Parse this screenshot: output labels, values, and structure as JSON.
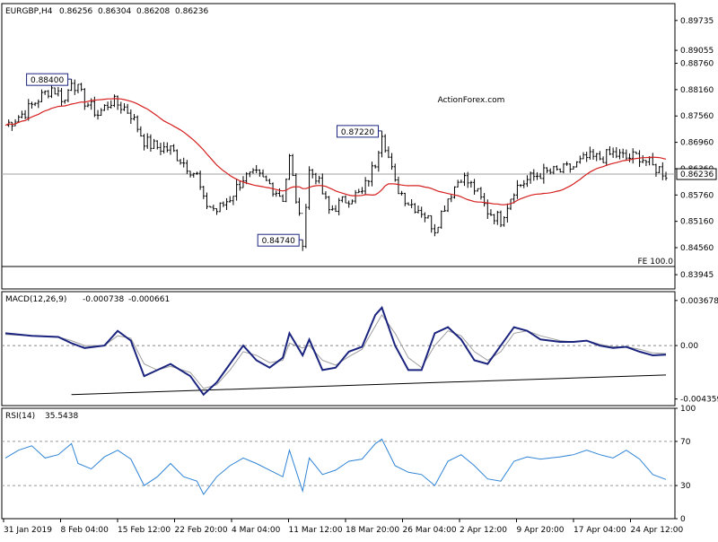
{
  "watermark": "ActionForex.com",
  "colors": {
    "background": "#ffffff",
    "frame": "#000000",
    "candle": "#000000",
    "ma": "#d62020",
    "macd": "#1a237e",
    "signal": "#9e9e9e",
    "rsi": "#2f84d6",
    "trendline": "#000000",
    "price_line": "#a0a0a0",
    "label_border": "#1a237e"
  },
  "chart_data": [
    {
      "type": "candlestick",
      "title": "EURGBP,H4",
      "ohlc_readout": [
        "0.86256",
        "0.86304",
        "0.86208",
        "0.86236"
      ],
      "ylim": [
        0.8362,
        0.9012
      ],
      "y_ticks": [
        "0.89735",
        "0.89055",
        "0.88760",
        "0.88160",
        "0.87560",
        "0.86960",
        "0.86360",
        "0.85760",
        "0.85160",
        "0.84560",
        "0.83945"
      ],
      "y_tick_values": [
        0.89735,
        0.89055,
        0.8876,
        0.8816,
        0.8756,
        0.8696,
        0.8636,
        0.8576,
        0.8516,
        0.8456,
        0.83945
      ],
      "current_price_label": "0.86236",
      "current_price": 0.86236,
      "fe_line_label": "FE 100.0",
      "fe_line_value": 0.8413,
      "ma_overlay": true,
      "x_ticks": [
        "31 Jan 2019",
        "8 Feb 04:00",
        "15 Feb 12:00",
        "22 Feb 20:00",
        "4 Mar 04:00",
        "11 Mar 12:00",
        "18 Mar 20:00",
        "26 Mar 04:00",
        "2 Apr 12:00",
        "9 Apr 20:00",
        "17 Apr 04:00",
        "24 Apr 12:00"
      ],
      "annotations": [
        {
          "label": "0.88400",
          "value": 0.884,
          "x_index": 10
        },
        {
          "label": "0.87220",
          "value": 0.8722,
          "x_index": 57
        },
        {
          "label": "0.84740",
          "value": 0.8474,
          "x_index": 45
        }
      ],
      "anchors": [
        [
          0,
          0.8735
        ],
        [
          3,
          0.8765
        ],
        [
          5,
          0.8795
        ],
        [
          7,
          0.882
        ],
        [
          8,
          0.8808
        ],
        [
          9,
          0.879
        ],
        [
          10,
          0.884
        ],
        [
          12,
          0.879
        ],
        [
          14,
          0.876
        ],
        [
          16,
          0.879
        ],
        [
          18,
          0.8775
        ],
        [
          19,
          0.876
        ],
        [
          21,
          0.87
        ],
        [
          22,
          0.869
        ],
        [
          23,
          0.8685
        ],
        [
          25,
          0.868
        ],
        [
          27,
          0.865
        ],
        [
          29,
          0.862
        ],
        [
          30,
          0.856
        ],
        [
          32,
          0.854
        ],
        [
          34,
          0.857
        ],
        [
          36,
          0.8615
        ],
        [
          38,
          0.862
        ],
        [
          40,
          0.86
        ],
        [
          42,
          0.857
        ],
        [
          43,
          0.866
        ],
        [
          45,
          0.8474
        ],
        [
          46,
          0.863
        ],
        [
          47,
          0.862
        ],
        [
          49,
          0.854
        ],
        [
          51,
          0.856
        ],
        [
          52,
          0.857
        ],
        [
          54,
          0.858
        ],
        [
          56,
          0.865
        ],
        [
          57,
          0.8722
        ],
        [
          59,
          0.86
        ],
        [
          61,
          0.856
        ],
        [
          63,
          0.854
        ],
        [
          65,
          0.85
        ],
        [
          67,
          0.857
        ],
        [
          69,
          0.862
        ],
        [
          71,
          0.859
        ],
        [
          73,
          0.854
        ],
        [
          75,
          0.852
        ],
        [
          77,
          0.859
        ],
        [
          79,
          0.861
        ],
        [
          81,
          0.8625
        ],
        [
          84,
          0.863
        ],
        [
          86,
          0.864
        ],
        [
          88,
          0.866
        ],
        [
          90,
          0.866
        ],
        [
          92,
          0.867
        ],
        [
          94,
          0.866
        ],
        [
          96,
          0.8665
        ],
        [
          98,
          0.864
        ],
        [
          99,
          0.8635
        ],
        [
          100,
          0.86236
        ]
      ]
    },
    {
      "type": "line",
      "title": "MACD(12,26,9)",
      "readout": [
        "-0.000738",
        "-0.000661"
      ],
      "ylim": [
        -0.0049,
        0.0044
      ],
      "y_ticks": [
        "0.003678",
        "0.00",
        "-0.004359"
      ],
      "y_tick_values": [
        0.003678,
        0.0,
        -0.004359
      ],
      "zero_line": 0.0,
      "trendline": {
        "x": [
          10,
          100
        ],
        "y": [
          -0.004,
          -0.0024
        ]
      },
      "series": [
        {
          "points": [
            [
              0,
              0.001
            ],
            [
              4,
              0.0008
            ],
            [
              8,
              0.0007
            ],
            [
              10,
              0.0002
            ],
            [
              12,
              -0.0002
            ],
            [
              15,
              0.0
            ],
            [
              17,
              0.0012
            ],
            [
              19,
              0.0004
            ],
            [
              21,
              -0.0025
            ],
            [
              23,
              -0.002
            ],
            [
              25,
              -0.0015
            ],
            [
              28,
              -0.0025
            ],
            [
              30,
              -0.004
            ],
            [
              32,
              -0.003
            ],
            [
              34,
              -0.0015
            ],
            [
              36,
              0.0
            ],
            [
              38,
              -0.0012
            ],
            [
              40,
              -0.0018
            ],
            [
              42,
              -0.001
            ],
            [
              43,
              0.001
            ],
            [
              45,
              -0.0008
            ],
            [
              46,
              0.0005
            ],
            [
              48,
              -0.002
            ],
            [
              50,
              -0.0018
            ],
            [
              52,
              -0.0005
            ],
            [
              54,
              -0.0001
            ],
            [
              56,
              0.0025
            ],
            [
              57,
              0.0031
            ],
            [
              59,
              0.0
            ],
            [
              61,
              -0.002
            ],
            [
              63,
              -0.002
            ],
            [
              65,
              0.001
            ],
            [
              67,
              0.0015
            ],
            [
              69,
              0.0005
            ],
            [
              71,
              -0.0012
            ],
            [
              73,
              -0.0015
            ],
            [
              75,
              0.0
            ],
            [
              77,
              0.0015
            ],
            [
              79,
              0.0012
            ],
            [
              81,
              0.0005
            ],
            [
              84,
              0.0003
            ],
            [
              86,
              0.0003
            ],
            [
              88,
              0.0004
            ],
            [
              90,
              0.0
            ],
            [
              92,
              -0.0002
            ],
            [
              94,
              -0.0001
            ],
            [
              96,
              -0.0005
            ],
            [
              98,
              -0.0008
            ],
            [
              100,
              -0.000738
            ]
          ]
        },
        {
          "points": [
            [
              0,
              0.0009
            ],
            [
              4,
              0.0008
            ],
            [
              8,
              0.0007
            ],
            [
              10,
              0.0004
            ],
            [
              12,
              0.0
            ],
            [
              15,
              0.0
            ],
            [
              17,
              0.0008
            ],
            [
              19,
              0.0006
            ],
            [
              21,
              -0.0015
            ],
            [
              23,
              -0.002
            ],
            [
              25,
              -0.0017
            ],
            [
              28,
              -0.0022
            ],
            [
              30,
              -0.0035
            ],
            [
              32,
              -0.0032
            ],
            [
              34,
              -0.002
            ],
            [
              36,
              -0.0005
            ],
            [
              38,
              -0.0008
            ],
            [
              40,
              -0.0014
            ],
            [
              42,
              -0.0012
            ],
            [
              43,
              0.0002
            ],
            [
              45,
              -0.0002
            ],
            [
              46,
              0.0
            ],
            [
              48,
              -0.0012
            ],
            [
              50,
              -0.0016
            ],
            [
              52,
              -0.0009
            ],
            [
              54,
              -0.0003
            ],
            [
              56,
              0.0016
            ],
            [
              57,
              0.0025
            ],
            [
              59,
              0.001
            ],
            [
              61,
              -0.001
            ],
            [
              63,
              -0.0018
            ],
            [
              65,
              0.0
            ],
            [
              67,
              0.0012
            ],
            [
              69,
              0.0008
            ],
            [
              71,
              -0.0005
            ],
            [
              73,
              -0.0012
            ],
            [
              75,
              -0.0005
            ],
            [
              77,
              0.001
            ],
            [
              79,
              0.0012
            ],
            [
              81,
              0.0008
            ],
            [
              84,
              0.0004
            ],
            [
              86,
              0.0003
            ],
            [
              88,
              0.0004
            ],
            [
              90,
              0.0001
            ],
            [
              92,
              -0.0001
            ],
            [
              94,
              -0.0001
            ],
            [
              96,
              -0.0003
            ],
            [
              98,
              -0.0006
            ],
            [
              100,
              -0.000661
            ]
          ]
        }
      ]
    },
    {
      "type": "line",
      "title": "RSI(14)",
      "readout": "35.5438",
      "ylim": [
        0,
        100
      ],
      "y_ticks": [
        "100",
        "70",
        "30",
        "0"
      ],
      "y_tick_values": [
        100,
        70,
        30,
        0
      ],
      "levels": [
        70,
        30
      ],
      "series": [
        {
          "points": [
            [
              0,
              55
            ],
            [
              2,
              62
            ],
            [
              4,
              66
            ],
            [
              6,
              55
            ],
            [
              8,
              58
            ],
            [
              10,
              68
            ],
            [
              11,
              50
            ],
            [
              13,
              45
            ],
            [
              15,
              56
            ],
            [
              17,
              62
            ],
            [
              19,
              54
            ],
            [
              21,
              30
            ],
            [
              23,
              38
            ],
            [
              25,
              50
            ],
            [
              27,
              38
            ],
            [
              29,
              34
            ],
            [
              30,
              22
            ],
            [
              32,
              38
            ],
            [
              34,
              48
            ],
            [
              36,
              55
            ],
            [
              38,
              50
            ],
            [
              40,
              44
            ],
            [
              42,
              38
            ],
            [
              43,
              62
            ],
            [
              45,
              25
            ],
            [
              46,
              55
            ],
            [
              48,
              40
            ],
            [
              50,
              44
            ],
            [
              52,
              52
            ],
            [
              54,
              54
            ],
            [
              56,
              68
            ],
            [
              57,
              72
            ],
            [
              59,
              48
            ],
            [
              61,
              42
            ],
            [
              63,
              40
            ],
            [
              65,
              30
            ],
            [
              67,
              52
            ],
            [
              69,
              58
            ],
            [
              71,
              48
            ],
            [
              73,
              36
            ],
            [
              75,
              34
            ],
            [
              77,
              52
            ],
            [
              79,
              56
            ],
            [
              81,
              54
            ],
            [
              84,
              56
            ],
            [
              86,
              58
            ],
            [
              88,
              62
            ],
            [
              90,
              58
            ],
            [
              92,
              55
            ],
            [
              94,
              62
            ],
            [
              96,
              54
            ],
            [
              98,
              40
            ],
            [
              100,
              35.5438
            ]
          ]
        }
      ]
    }
  ]
}
